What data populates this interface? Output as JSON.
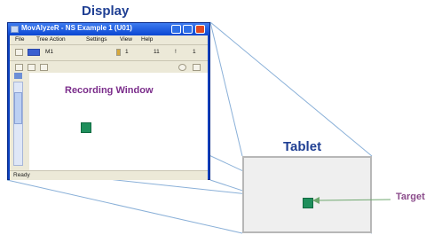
{
  "labels": {
    "display": "Display",
    "tablet": "Tablet",
    "target": "Target"
  },
  "window": {
    "title": "MovAlyzeR - NS Example 1 (U01)",
    "menu": [
      "File",
      "Tree Action",
      "Settings",
      "View",
      "Help"
    ],
    "recording_label": "Recording Window",
    "status": "Ready",
    "toolbar_text": [
      "M1",
      "1",
      "11",
      "!",
      "1"
    ]
  },
  "colors": {
    "title_label": "#1f3f93",
    "recording_label": "#7b2d8b",
    "target_label": "#8a4a8a",
    "target_square": "#1f8f5c",
    "connector": "#8ab0d8",
    "arrow": "#6fa86f"
  }
}
